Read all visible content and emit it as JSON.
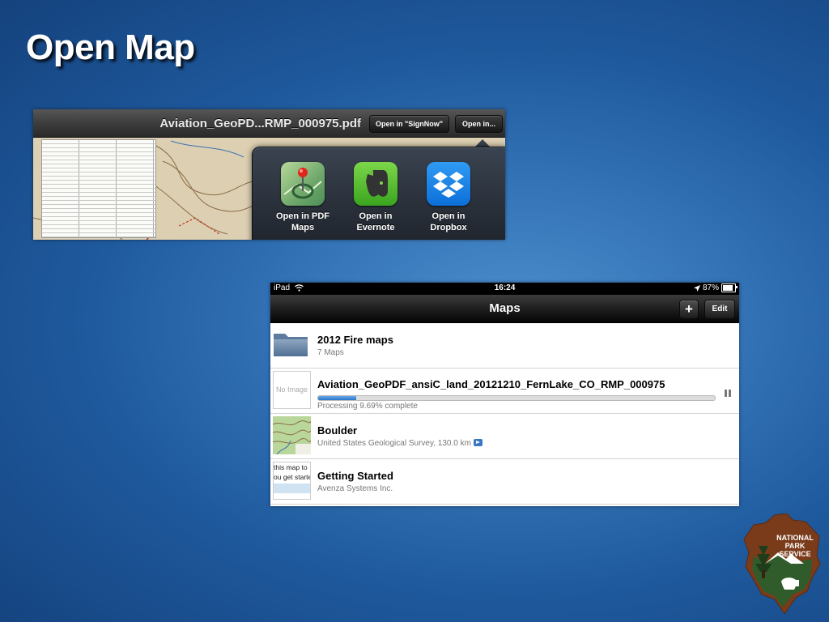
{
  "slide": {
    "title": "Open Map"
  },
  "screenshot1": {
    "document_title": "Aviation_GeoPD...RMP_000975.pdf",
    "buttons": {
      "open_in_signnow": "Open in \"SignNow\"",
      "open_in": "Open in..."
    },
    "apps": [
      {
        "line1": "Open in PDF",
        "line2": "Maps",
        "icon": "pdf-maps-icon",
        "color": "#6fa76b"
      },
      {
        "line1": "Open in",
        "line2": "Evernote",
        "icon": "evernote-icon",
        "color": "#3aa51f"
      },
      {
        "line1": "Open in",
        "line2": "Dropbox",
        "icon": "dropbox-icon",
        "color": "#0d6fd9"
      }
    ]
  },
  "screenshot2": {
    "status_bar": {
      "device": "iPad",
      "time": "16:24",
      "battery": "87%",
      "battery_level": 0.87
    },
    "nav": {
      "title": "Maps",
      "add_label": "+",
      "edit_label": "Edit"
    },
    "rows": {
      "folder": {
        "title": "2012 Fire maps",
        "subtitle": "7 Maps"
      },
      "processing": {
        "title": "Aviation_GeoPDF_ansiC_land_20121210_FernLake_CO_RMP_000975",
        "thumb_text": "No Image",
        "status": "Processing 9.69% complete",
        "progress": 0.0969
      },
      "boulder": {
        "title": "Boulder",
        "subtitle": "United States Geological Survey, 130.0 km"
      },
      "getting_started": {
        "title": "Getting Started",
        "subtitle": "Avenza Systems Inc.",
        "thumb_line1": "this map to",
        "thumb_line2": "ou get starte"
      }
    }
  },
  "logo": {
    "line1": "NATIONAL",
    "line2": "PARK",
    "line3": "SERVICE"
  },
  "colors": {
    "accent": "#2a74c8",
    "nps_brown": "#7a3b1a",
    "nps_green": "#2f5c2a"
  }
}
